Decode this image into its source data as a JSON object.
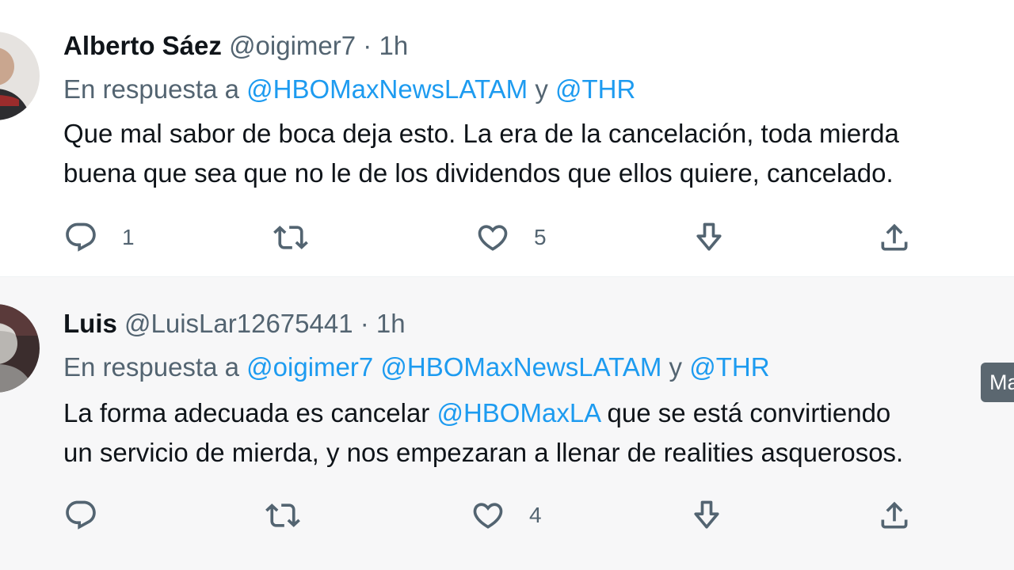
{
  "tweets": [
    {
      "name": "Alberto Sáez",
      "handle": "@oigimer7",
      "time": "1h",
      "reply_prefix": "En respuesta a",
      "reply_to": [
        {
          "text": "@HBOMaxNewsLATAM",
          "type": "mention"
        },
        {
          "text": " y ",
          "type": "plain"
        },
        {
          "text": "@THR",
          "type": "mention"
        }
      ],
      "text_lines": [
        [
          {
            "text": "Que mal sabor de boca deja esto. La era de la cancelación, toda mierda",
            "type": "plain"
          }
        ],
        [
          {
            "text": "buena que sea que no le de los dividendos que ellos quiere, cancelado.",
            "type": "plain"
          }
        ]
      ],
      "actions": {
        "reply_count": "1",
        "retweet_count": "",
        "like_count": "5"
      }
    },
    {
      "name": "Luis",
      "handle": "@LuisLar12675441",
      "time": "1h",
      "reply_prefix": "En respuesta a",
      "reply_to": [
        {
          "text": "@oigimer7",
          "type": "mention"
        },
        {
          "text": " ",
          "type": "plain"
        },
        {
          "text": "@HBOMaxNewsLATAM",
          "type": "mention"
        },
        {
          "text": " y ",
          "type": "plain"
        },
        {
          "text": "@THR",
          "type": "mention"
        }
      ],
      "text_lines": [
        [
          {
            "text": "La forma adecuada es cancelar ",
            "type": "plain"
          },
          {
            "text": "@HBOMaxLA",
            "type": "mention"
          },
          {
            "text": " que se está convirtiendo",
            "type": "plain"
          }
        ],
        [
          {
            "text": "un servicio de mierda, y nos empezaran a llenar de realities asquerosos.",
            "type": "plain"
          }
        ]
      ],
      "actions": {
        "reply_count": "",
        "retweet_count": "",
        "like_count": "4"
      }
    }
  ],
  "tooltip": "Ma",
  "icons": {
    "reply": "reply-bubble-icon",
    "retweet": "retweet-icon",
    "like": "heart-icon",
    "download": "download-arrow-icon",
    "share": "share-upload-icon"
  },
  "colors": {
    "mention": "#1d9bf0",
    "secondary_text": "#536471",
    "primary_text": "#0f1419",
    "hover_bg": "#f7f7f8"
  }
}
